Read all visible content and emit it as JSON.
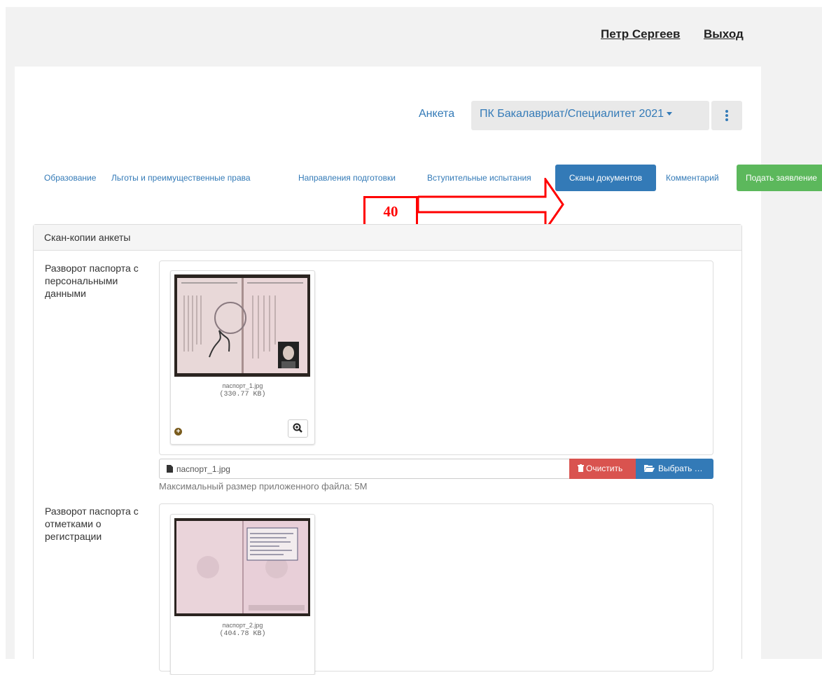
{
  "header": {
    "user_name": "Петр Сергеев",
    "logout": "Выход"
  },
  "anketa": {
    "label": "Анкета",
    "selected": "ПК Бакалавриат/Специалитет 2021"
  },
  "tabs": [
    {
      "label": "Образование"
    },
    {
      "label": "Льготы и преимущественные права"
    },
    {
      "label": "Направления подготовки"
    },
    {
      "label": "Вступительные испытания"
    },
    {
      "label": "Сканы документов",
      "active": true
    },
    {
      "label": "Комментарий"
    },
    {
      "label": "Подать заявление"
    }
  ],
  "annotation": {
    "number": "40",
    "color": "#ff0000"
  },
  "panel": {
    "title": "Скан-копии анкеты"
  },
  "documents": [
    {
      "label": "Разворот паспорта с персональными данными",
      "file_name": "паспорт_1.jpg",
      "file_size": "(330.77 KB)",
      "input_value": "паспорт_1.jpg",
      "clear_label": "Очистить",
      "choose_label": "Выбрать …",
      "help": "Максимальный размер приложенного файла: 5M"
    },
    {
      "label": "Разворот паспорта с отметками о регистрации",
      "file_name": "паспорт_2.jpg",
      "file_size": "(404.78 KB)"
    }
  ],
  "colors": {
    "primary": "#337ab7",
    "danger": "#d9534f",
    "success": "#5cb85c",
    "annotation": "#ff0000"
  }
}
